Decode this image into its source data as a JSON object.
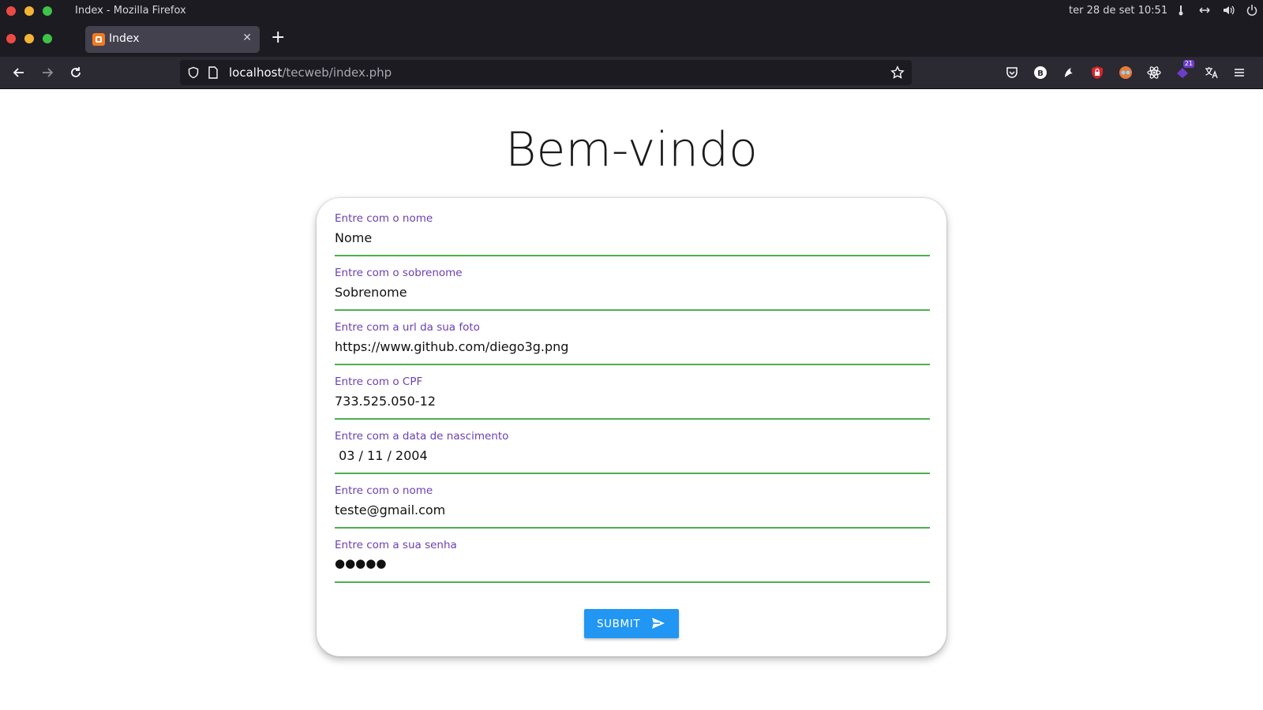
{
  "os": {
    "window_title": "Index - Mozilla Firefox",
    "clock": "ter 28 de set  10:51"
  },
  "browser": {
    "tab_label": "Index",
    "tab_close": "✕",
    "new_tab": "+",
    "url_host": "localhost",
    "url_path": "/tecweb/index.php",
    "extension_badge": "21"
  },
  "page": {
    "title": "Bem-vindo",
    "fields": [
      {
        "label": "Entre com o nome",
        "value": "Nome"
      },
      {
        "label": "Entre com o sobrenome",
        "value": "Sobrenome"
      },
      {
        "label": "Entre com a url da sua foto",
        "value": "https://www.github.com/diego3g.png"
      },
      {
        "label": "Entre com o CPF",
        "value": "733.525.050-12"
      },
      {
        "label": "Entre com a data de nascimento",
        "value": " 03 / 11 / 2004"
      },
      {
        "label": "Entre com o nome",
        "value": "teste@gmail.com"
      },
      {
        "label": "Entre com a sua senha",
        "value": "●●●●●"
      }
    ],
    "submit_label": "SUBMIT"
  },
  "colors": {
    "label": "#6a3fb5",
    "underline": "#4caf50",
    "submit": "#2196f3"
  }
}
